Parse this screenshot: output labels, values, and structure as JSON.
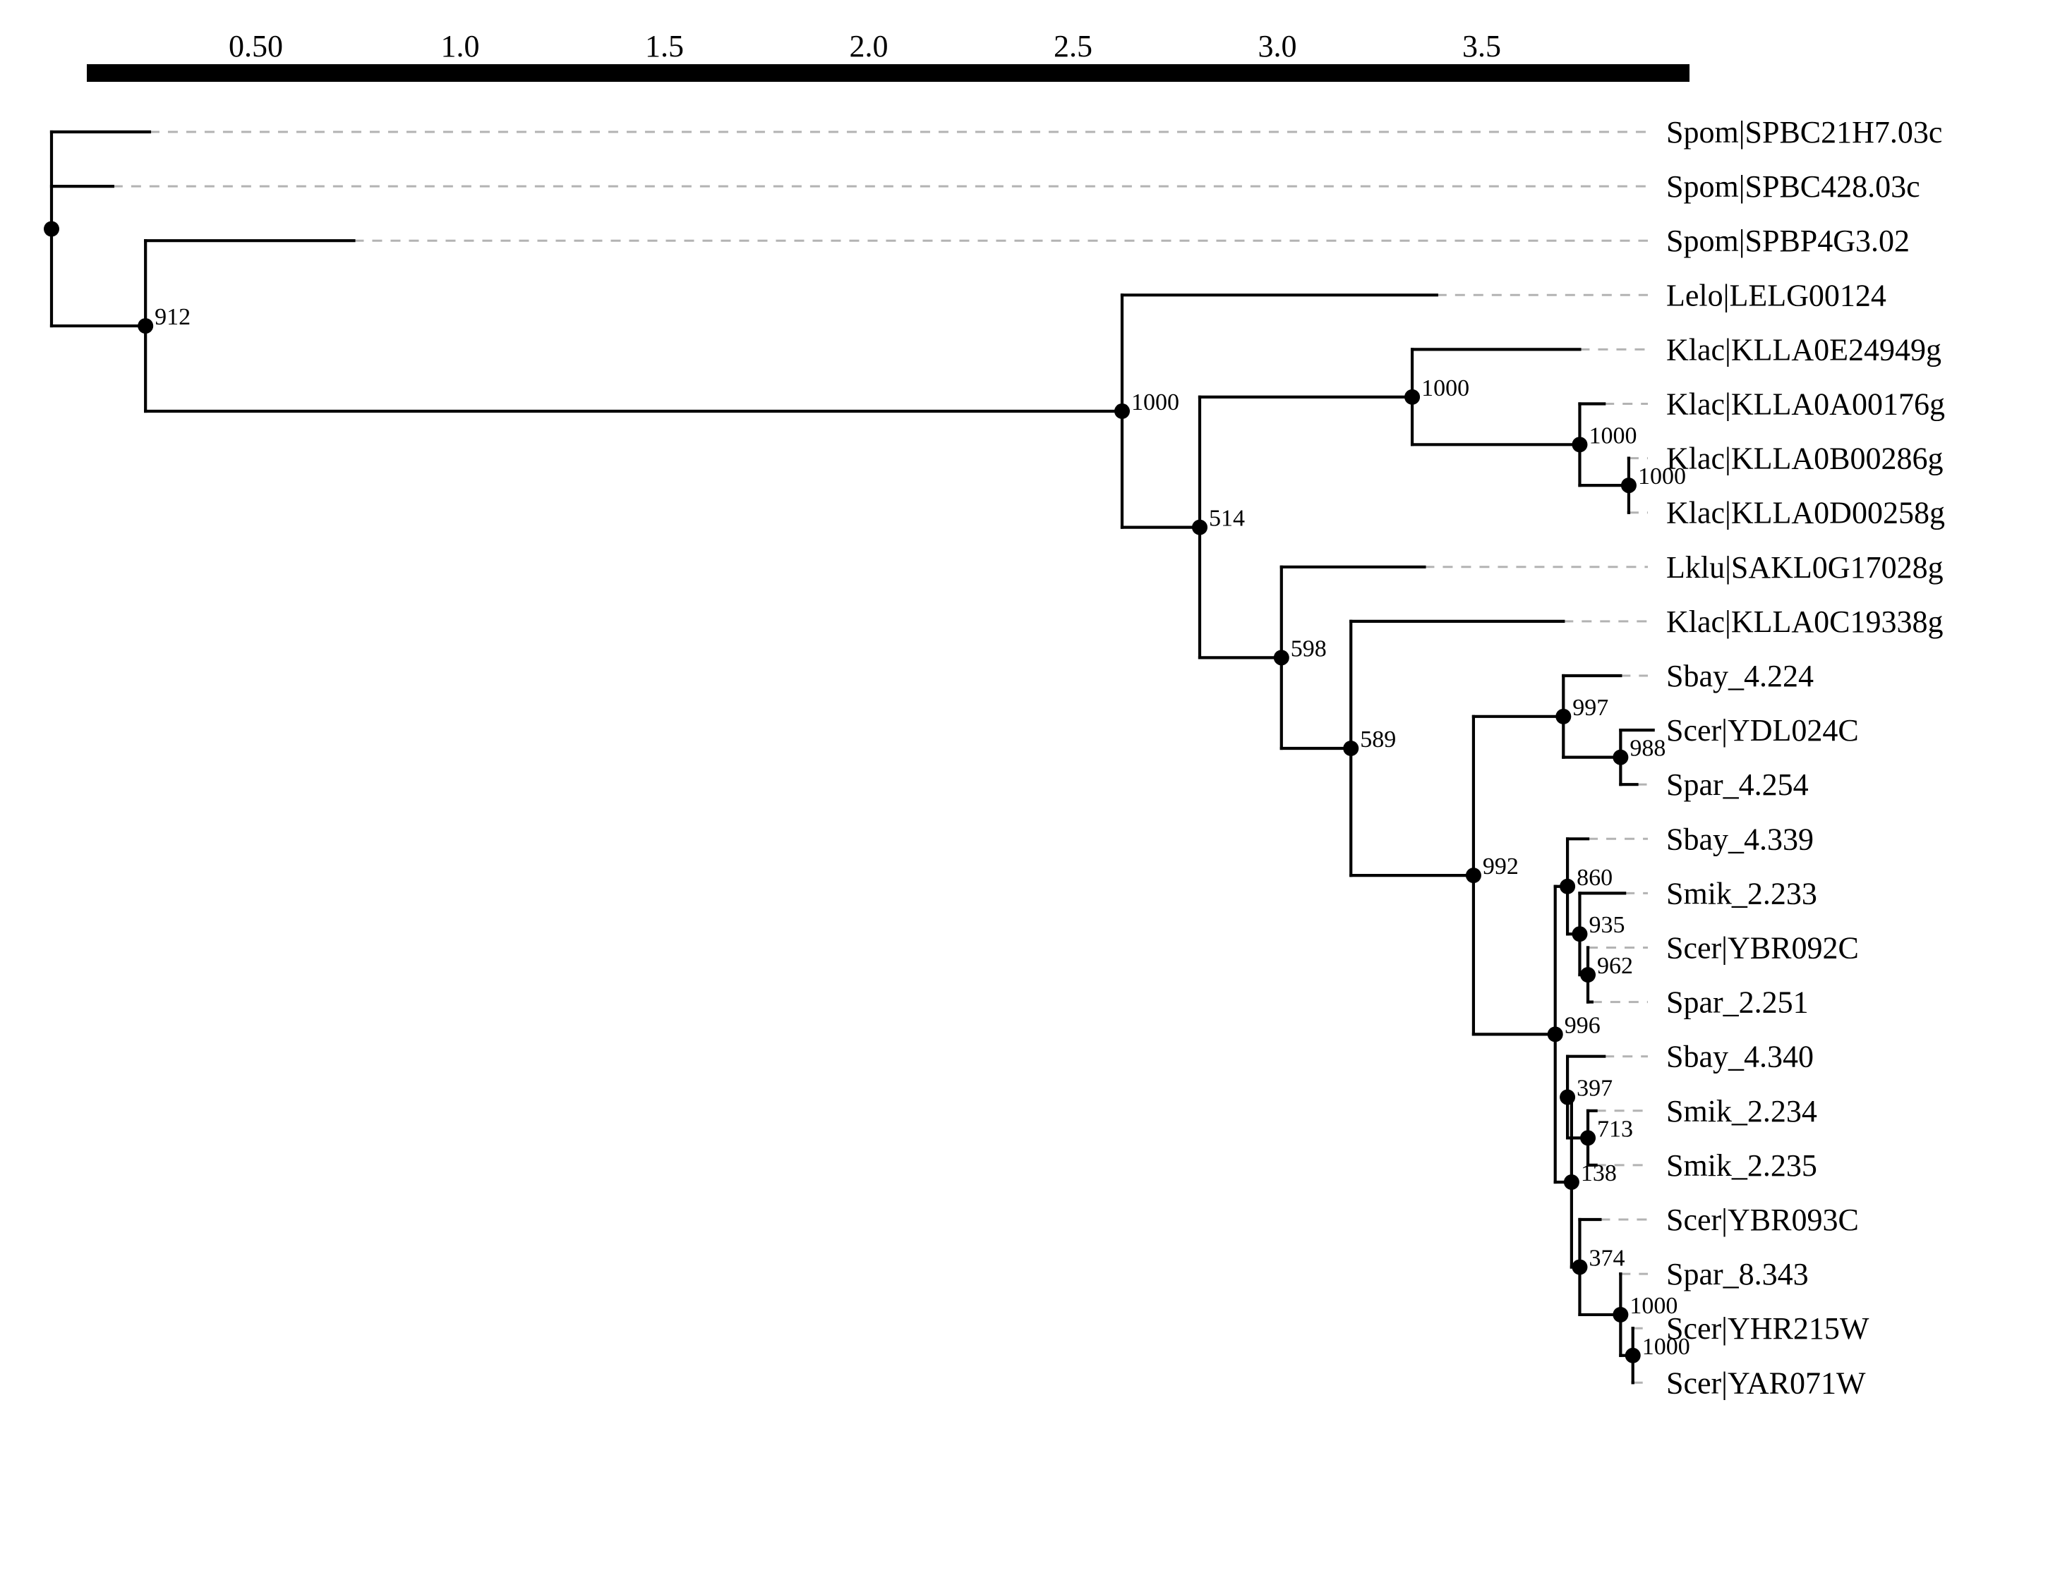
{
  "scale": {
    "ticks": [
      {
        "value": 0.5,
        "label": "0.50"
      },
      {
        "value": 1.0,
        "label": "1.0"
      },
      {
        "value": 1.5,
        "label": "1.5"
      },
      {
        "value": 2.0,
        "label": "2.0"
      },
      {
        "value": 2.5,
        "label": "2.5"
      },
      {
        "value": 3.0,
        "label": "3.0"
      },
      {
        "value": 3.5,
        "label": "3.5"
      }
    ]
  },
  "tree": {
    "support": null,
    "depth": 0.0,
    "children": [
      {
        "leaf": "Spom|SPBC21H7.03c",
        "depth": 0.24
      },
      {
        "leaf": "Spom|SPBC428.03c",
        "depth": 0.15
      },
      {
        "support": "912",
        "depth": 0.23,
        "children": [
          {
            "leaf": "Spom|SPBP4G3.02",
            "depth": 0.74
          },
          {
            "support": "1000",
            "depth": 2.62,
            "children": [
              {
                "leaf": "Lelo|LELG00124",
                "depth": 3.39
              },
              {
                "support": "514",
                "depth": 2.81,
                "children": [
                  {
                    "support": "1000",
                    "depth": 3.33,
                    "children": [
                      {
                        "leaf": "Klac|KLLA0E24949g",
                        "depth": 3.74
                      },
                      {
                        "support": "1000",
                        "depth": 3.74,
                        "children": [
                          {
                            "leaf": "Klac|KLLA0A00176g",
                            "depth": 3.8
                          },
                          {
                            "support": "1000",
                            "depth": 3.86,
                            "children": [
                              {
                                "leaf": "Klac|KLLA0B00286g",
                                "depth": 3.86
                              },
                              {
                                "leaf": "Klac|KLLA0D00258g",
                                "depth": 3.86
                              }
                            ]
                          }
                        ]
                      }
                    ]
                  },
                  {
                    "support": "598",
                    "depth": 3.01,
                    "children": [
                      {
                        "leaf": "Lklu|SAKL0G17028g",
                        "depth": 3.36
                      },
                      {
                        "support": "589",
                        "depth": 3.18,
                        "children": [
                          {
                            "leaf": "Klac|KLLA0C19338g",
                            "depth": 3.7
                          },
                          {
                            "support": "992",
                            "depth": 3.48,
                            "children": [
                              {
                                "support": "997",
                                "depth": 3.7,
                                "children": [
                                  {
                                    "leaf": "Sbay_4.224",
                                    "depth": 3.84
                                  },
                                  {
                                    "support": "988",
                                    "depth": 3.84,
                                    "children": [
                                      {
                                        "leaf": "Scer|YDL024C",
                                        "depth": 3.92
                                      },
                                      {
                                        "leaf": "Spar_4.254",
                                        "depth": 3.88
                                      }
                                    ]
                                  }
                                ]
                              },
                              {
                                "support": "996",
                                "depth": 3.68,
                                "children": [
                                  {
                                    "support": "860",
                                    "depth": 3.71,
                                    "children": [
                                      {
                                        "leaf": "Sbay_4.339",
                                        "depth": 3.76
                                      },
                                      {
                                        "support": "935",
                                        "depth": 3.74,
                                        "children": [
                                          {
                                            "leaf": "Smik_2.233",
                                            "depth": 3.85
                                          },
                                          {
                                            "support": "962",
                                            "depth": 3.76,
                                            "children": [
                                              {
                                                "leaf": "Scer|YBR092C",
                                                "depth": 3.76
                                              },
                                              {
                                                "leaf": "Spar_2.251",
                                                "depth": 3.77
                                              }
                                            ]
                                          }
                                        ]
                                      }
                                    ]
                                  },
                                  {
                                    "support": "138",
                                    "depth": 3.72,
                                    "children": [
                                      {
                                        "support": "397",
                                        "depth": 3.71,
                                        "children": [
                                          {
                                            "leaf": "Sbay_4.340",
                                            "depth": 3.8
                                          },
                                          {
                                            "support": "713",
                                            "depth": 3.76,
                                            "children": [
                                              {
                                                "leaf": "Smik_2.234",
                                                "depth": 3.78
                                              },
                                              {
                                                "leaf": "Smik_2.235",
                                                "depth": 3.78
                                              }
                                            ]
                                          }
                                        ]
                                      },
                                      {
                                        "support": "374",
                                        "depth": 3.74,
                                        "children": [
                                          {
                                            "leaf": "Scer|YBR093C",
                                            "depth": 3.79
                                          },
                                          {
                                            "support": "1000",
                                            "depth": 3.84,
                                            "children": [
                                              {
                                                "leaf": "Spar_8.343",
                                                "depth": 3.84
                                              },
                                              {
                                                "support": "1000",
                                                "depth": 3.87,
                                                "children": [
                                                  {
                                                    "leaf": "Scer|YHR215W",
                                                    "depth": 3.87
                                                  },
                                                  {
                                                    "leaf": "Scer|YAR071W",
                                                    "depth": 3.87
                                                  }
                                                ]
                                              }
                                            ]
                                          }
                                        ]
                                      }
                                    ]
                                  }
                                ]
                              }
                            ]
                          }
                        ]
                      }
                    ]
                  }
                ]
              }
            ]
          }
        ]
      }
    ]
  }
}
